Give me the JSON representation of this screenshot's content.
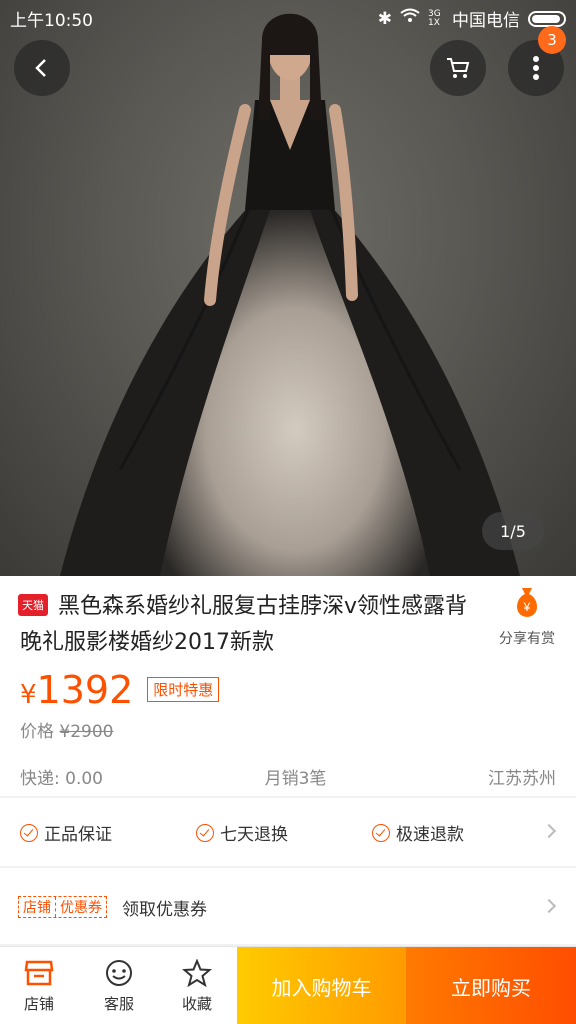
{
  "status_bar": {
    "time": "上午10:50",
    "network": "3G 1X",
    "carrier": "中国电信"
  },
  "gallery": {
    "pager": "1/5",
    "cart_badge": "3"
  },
  "product": {
    "store_tag": "天猫",
    "title": "黑色森系婚纱礼服复古挂脖深v领性感露背晚礼服影楼婚纱2017新款",
    "share_label": "分享有赏",
    "share_icon": "¥",
    "currency": "¥",
    "price": "1392",
    "promo_label": "限时特惠",
    "old_price_label": "价格",
    "old_price": "¥2900",
    "shipping": "快递: 0.00",
    "monthly_sales": "月销3笔",
    "location": "江苏苏州"
  },
  "guarantees": [
    "正品保证",
    "七天退换",
    "极速退款"
  ],
  "coupon": {
    "tag_left": "店铺",
    "tag_right": "优惠券",
    "label": "领取优惠券"
  },
  "bottom_bar": {
    "store": "店铺",
    "service": "客服",
    "favorite": "收藏",
    "add_to_cart": "加入购物车",
    "buy_now": "立即购买"
  },
  "colors": {
    "accent": "#ff5000",
    "cart_button": "#ffb400",
    "buy_button": "#ff5a00",
    "tmall_red": "#e4212a"
  }
}
